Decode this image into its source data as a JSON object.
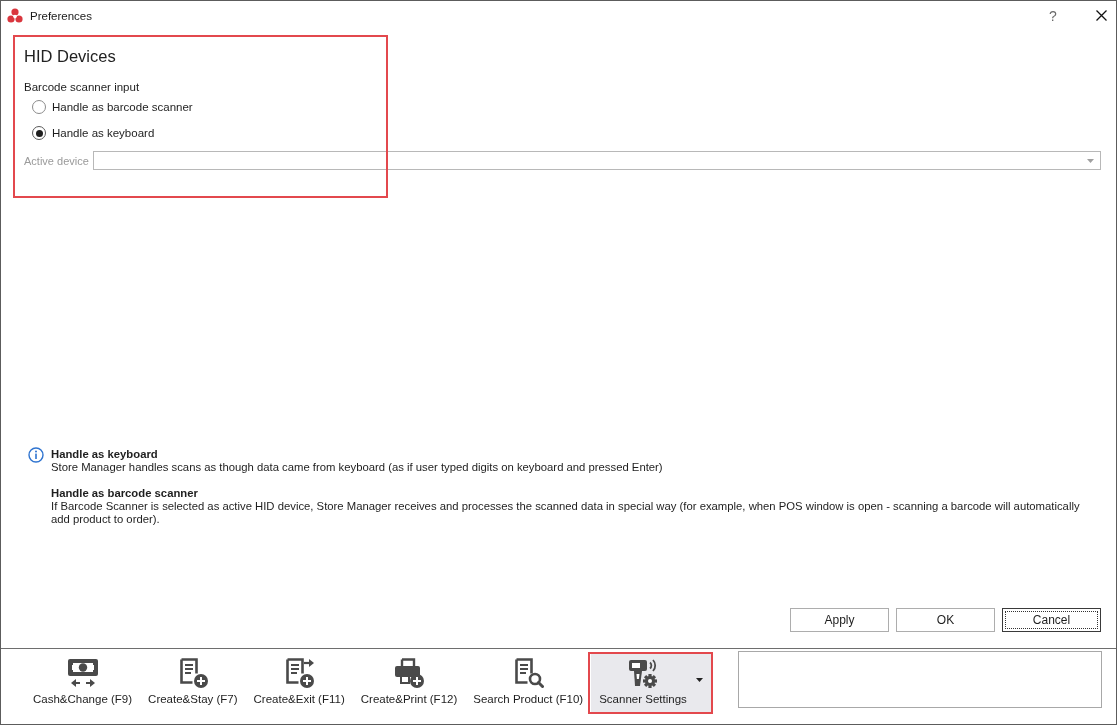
{
  "window": {
    "title": "Preferences",
    "help_button": "?"
  },
  "section": {
    "title": "HID Devices",
    "highlighted": true,
    "group_label": "Barcode scanner input",
    "options": [
      {
        "label": "Handle as barcode scanner",
        "selected": false
      },
      {
        "label": "Handle as keyboard",
        "selected": true
      }
    ],
    "active_device": {
      "label": "Active device",
      "disabled": true
    }
  },
  "info": [
    {
      "title": "Handle as keyboard",
      "text": "Store Manager handles scans as though data came from keyboard (as if user typed digits on keyboard and pressed Enter)"
    },
    {
      "title": "Handle as barcode scanner",
      "text": "If Barcode Scanner is selected as active HID device, Store Manager receives and processes the scanned data in special way (for example, when POS window is open - scanning a barcode will automatically add product to order)."
    }
  ],
  "dialog_buttons": [
    {
      "label": "Apply",
      "focused": false
    },
    {
      "label": "OK",
      "focused": false
    },
    {
      "label": "Cancel",
      "focused": true
    }
  ],
  "toolbar": {
    "items": [
      {
        "kind": "cash",
        "label": "Cash&Change (F9)",
        "active": false,
        "highlighted": false,
        "dropdown": false
      },
      {
        "kind": "create_stay",
        "label": "Create&Stay (F7)",
        "active": false,
        "highlighted": false,
        "dropdown": false
      },
      {
        "kind": "create_exit",
        "label": "Create&Exit (F11)",
        "active": false,
        "highlighted": false,
        "dropdown": false
      },
      {
        "kind": "create_print",
        "label": "Create&Print (F12)",
        "active": false,
        "highlighted": false,
        "dropdown": false
      },
      {
        "kind": "search_product",
        "label": "Search Product (F10)",
        "active": false,
        "highlighted": false,
        "dropdown": false
      },
      {
        "kind": "scanner_settings",
        "label": "Scanner Settings",
        "active": true,
        "highlighted": true,
        "dropdown": true
      }
    ]
  }
}
